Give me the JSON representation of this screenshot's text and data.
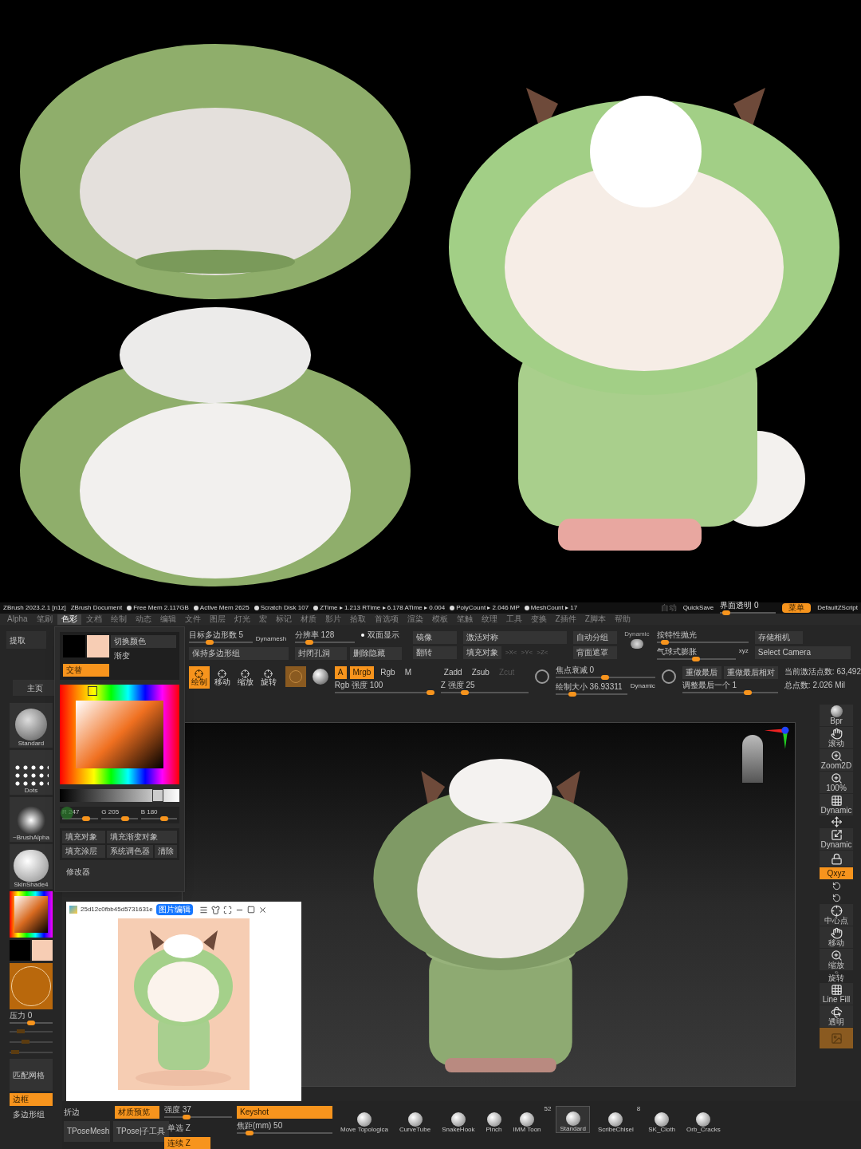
{
  "title_bar": {
    "app": "ZBrush 2023.2.1 [n1z]",
    "document": "ZBrush Document",
    "stats": [
      "Free Mem 2.117GB",
      "Active Mem 2625",
      "Scratch Disk 107",
      "ZTime ▸ 1.213 RTime ▸ 6.178 ATime ▸ 0.004",
      "PolyCount ▸ 2.046 MP",
      "MeshCount ▸ 17"
    ],
    "autosave": "自动",
    "quicksave": "QuickSave",
    "transparency": {
      "label": "界面透明 0",
      "level": 0.05
    },
    "menu_toggle": {
      "label": "菜单",
      "on": true
    },
    "script": "DefaultZScript"
  },
  "menu_bar": [
    {
      "label": "Alpha",
      "selected": false
    },
    {
      "label": "笔刷",
      "selected": false
    },
    {
      "label": "色彩",
      "selected": true
    },
    {
      "label": "文档",
      "selected": false
    },
    {
      "label": "绘制",
      "selected": false
    },
    {
      "label": "动态",
      "selected": false
    },
    {
      "label": "编辑",
      "selected": false
    },
    {
      "label": "文件",
      "selected": false
    },
    {
      "label": "图层",
      "selected": false
    },
    {
      "label": "灯光",
      "selected": false
    },
    {
      "label": "宏",
      "selected": false
    },
    {
      "label": "标记",
      "selected": false
    },
    {
      "label": "材质",
      "selected": false
    },
    {
      "label": "影片",
      "selected": false
    },
    {
      "label": "拾取",
      "selected": false
    },
    {
      "label": "首选项",
      "selected": false
    },
    {
      "label": "渲染",
      "selected": false
    },
    {
      "label": "模板",
      "selected": false
    },
    {
      "label": "笔触",
      "selected": false
    },
    {
      "label": "纹理",
      "selected": false
    },
    {
      "label": "工具",
      "selected": false
    },
    {
      "label": "变换",
      "selected": false
    },
    {
      "label": "Z插件",
      "selected": false
    },
    {
      "label": "Z脚本",
      "selected": false
    },
    {
      "label": "帮助",
      "selected": false
    }
  ],
  "geometry_row": {
    "extract": "提取",
    "target_polys": {
      "label": "目标多边形数 5",
      "level": 0.3
    },
    "dynamesh": "Dynamesh",
    "keep_groups": "保持多边形组",
    "resolution": {
      "label": "分辨率 128",
      "level": 0.2
    },
    "double_sided": {
      "label": "双面显示",
      "on": true
    },
    "close_holes": "封闭孔洞",
    "delete_hidden": "删除隐藏",
    "flip": "翻转",
    "mirror": "镜像",
    "activate_symmetry": "激活对称",
    "fill_object": "填充对象",
    "axes": [
      ">X<",
      ">Y<",
      ">Z<"
    ],
    "auto_groups": "自动分组",
    "backface_mask": "背面遮罩",
    "dynamic_label": "Dynamic",
    "polish_by_features": {
      "label": "按特性抛光",
      "level": 0.05
    },
    "inflate_balloon": {
      "label": "气球式膨胀",
      "level": 0.5
    },
    "xyz": "xyz",
    "store_camera": "存储相机",
    "select_camera": "Select Camera"
  },
  "brush_row": {
    "home": "主页",
    "modes": [
      {
        "label": "绘制",
        "selected": true
      },
      {
        "label": "移动",
        "selected": false
      },
      {
        "label": "缩放",
        "selected": false
      },
      {
        "label": "旋转",
        "selected": false
      }
    ],
    "channels": [
      {
        "label": "A",
        "on": true
      },
      {
        "label": "Mrgb",
        "on": true
      },
      {
        "label": "Rgb",
        "on": false
      },
      {
        "label": "M",
        "on": false
      }
    ],
    "rgb_intensity": {
      "label": "Rgb 强度 100",
      "level": 1
    },
    "z_modes": [
      {
        "label": "Zadd",
        "disabled": false
      },
      {
        "label": "Zsub",
        "disabled": false
      },
      {
        "label": "Zcut",
        "disabled": true
      }
    ],
    "z_intensity": {
      "label": "Z 强度 25",
      "level": 0.25
    },
    "focal_shift": {
      "label": "焦点衰减 0",
      "level": 0.5
    },
    "draw_size": {
      "label": "绘制大小 36.93311",
      "level": 0.2
    },
    "dynamic": "Dynamic",
    "redo_last": "重做最后",
    "redo_last_relative": "重做最后相对",
    "tweak_last": {
      "label": "调整最后一个 1",
      "level": 0.7
    },
    "active_points": "当前激活点数: 63,492",
    "total_points": "总点数: 2.026 Mil"
  },
  "color_popup": {
    "swatches": [
      {
        "color": "#000000"
      },
      {
        "color": "#f7cdb4"
      }
    ],
    "switch_color": "切换颜色",
    "gradient": "渐变",
    "alternate": {
      "label": "交替",
      "on": true
    },
    "gray_value": {
      "level": 0.85
    },
    "rgb": [
      {
        "label": "R 247",
        "level": 0.7
      },
      {
        "label": "G 205",
        "level": 0.7
      },
      {
        "label": "B 180",
        "level": 0.7
      }
    ],
    "fill_buttons": [
      "填充对象",
      "填充渐变对象",
      "填充涂层",
      "系统调色器",
      "清除"
    ],
    "modifiers": "修改器"
  },
  "left_shelf": {
    "brushes": [
      {
        "label": "Standard",
        "kind": "swirl"
      },
      {
        "label": "Dots",
        "kind": "dots"
      },
      {
        "label": "~BrushAlpha",
        "kind": "alpha"
      },
      {
        "label": "SkinShade4",
        "kind": "sphere"
      }
    ],
    "swatches": [
      {
        "color": "#000000"
      },
      {
        "color": "#f7cdb4"
      }
    ],
    "pressure": {
      "label": "压力 0",
      "level": 0.5
    },
    "dim_sliders": [
      {
        "level": 0.2
      },
      {
        "level": 0.35
      },
      {
        "level": 0.05
      }
    ],
    "match_mesh": "匹配网格",
    "frame": {
      "label": "边框",
      "on": true
    },
    "polygroups": {
      "label": "多边形组",
      "on": false
    }
  },
  "right_shelf": [
    {
      "kind": "sphere",
      "label": "Bpr"
    },
    {
      "kind": "hand",
      "label": "滚动"
    },
    {
      "kind": "zoom",
      "label": "Zoom2D"
    },
    {
      "kind": "zoom",
      "label": "100%"
    },
    {
      "kind": "grid",
      "label": "Dynamic"
    },
    {
      "kind": "axis"
    },
    {
      "kind": "symmetry",
      "label": "Dynamic"
    },
    {
      "kind": "lock"
    },
    {
      "kind": "toggle",
      "label": "Qxyz"
    },
    {
      "kind": "rotate"
    },
    {
      "kind": "rotate"
    },
    {
      "kind": "center",
      "label": "中心点"
    },
    {
      "kind": "hand",
      "label": "移动"
    },
    {
      "kind": "zoom",
      "label": "缩放"
    },
    {
      "kind": "rotate",
      "label": "旋转"
    },
    {
      "kind": "grid",
      "label": "Line Fill"
    },
    {
      "kind": "ghost",
      "label": "透明"
    },
    {
      "kind": "solo"
    }
  ],
  "image_viewer": {
    "title": "25d12c0fbb45d5731631e",
    "edit_button": "图片编辑"
  },
  "bottom_bar": {
    "crease": "折边",
    "material_preview": {
      "label": "材质预览",
      "on": true
    },
    "intensity": {
      "label": "强度 37",
      "level": 0.3
    },
    "keyshot": {
      "label": "Keyshot",
      "on": true
    },
    "tpose_mesh": "TPoseMesh",
    "tpose_subtool": "TPose|子工具",
    "single_z": {
      "label": "单选 Z",
      "on": false
    },
    "continuous_z": {
      "label": "连续 Z",
      "on": true
    },
    "focal_length": {
      "label": "焦距(mm) 50",
      "level": 0.1
    },
    "brushes": [
      {
        "label": "Move Topologica",
        "selected": false
      },
      {
        "label": "CurveTube",
        "selected": false
      },
      {
        "label": "SnakeHook",
        "selected": false
      },
      {
        "label": "Pinch",
        "selected": false
      },
      {
        "label": "IMM Toon",
        "count": "52",
        "selected": false
      },
      {
        "label": "Standard",
        "selected": true
      },
      {
        "label": "ScribeChisel",
        "count": "8",
        "selected": false
      },
      {
        "label": "SK_Cloth",
        "selected": false
      },
      {
        "label": "Orb_Cracks",
        "selected": false
      }
    ]
  }
}
